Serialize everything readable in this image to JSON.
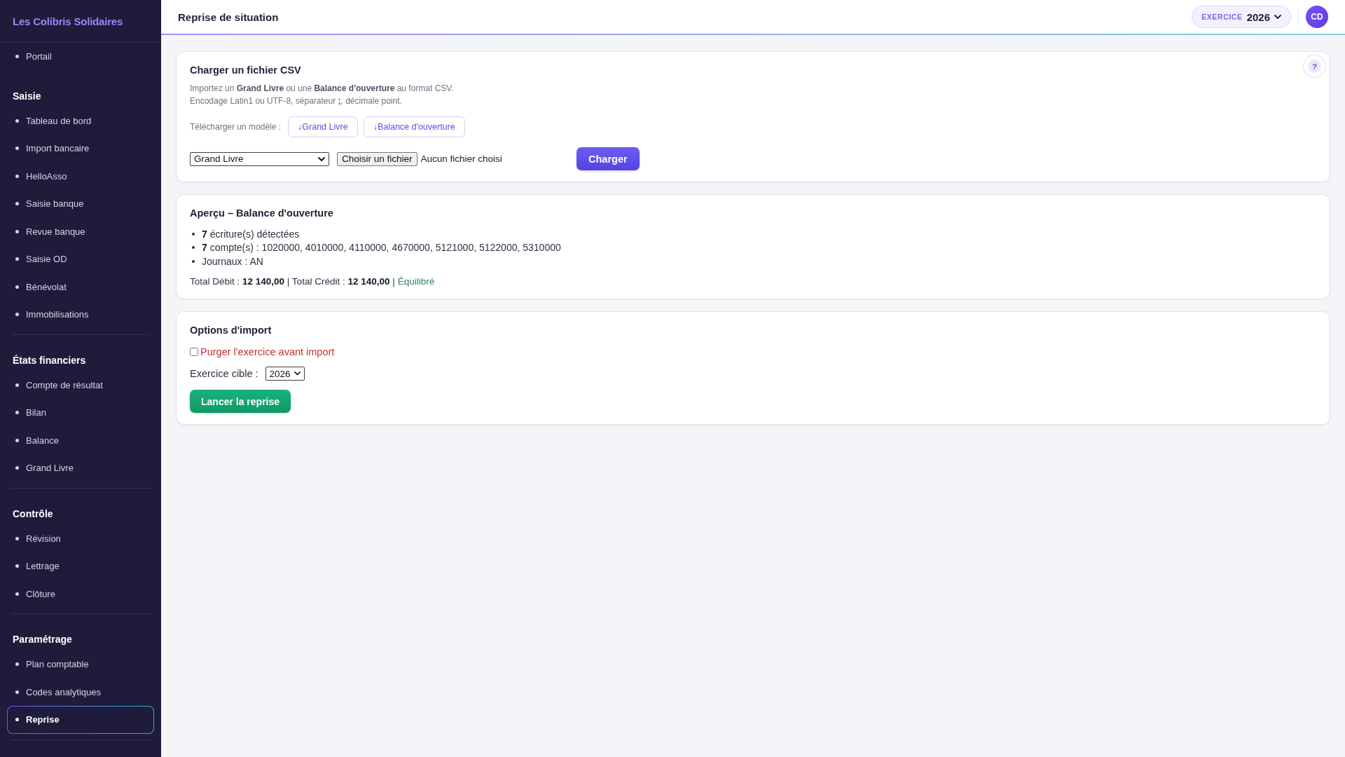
{
  "sidebar": {
    "brand": "Les Colibris Solidaires",
    "links": [
      {
        "label": "Portail",
        "selected": false
      }
    ],
    "sections": [
      {
        "title": "Saisie",
        "items": [
          {
            "label": "Tableau de bord",
            "selected": false
          },
          {
            "label": "Import bancaire",
            "selected": false
          },
          {
            "label": "HelloAsso",
            "selected": false
          },
          {
            "label": "Saisie banque",
            "selected": false
          },
          {
            "label": "Revue banque",
            "selected": false
          },
          {
            "label": "Saisie OD",
            "selected": false
          },
          {
            "label": "Bénévolat",
            "selected": false
          },
          {
            "label": "Immobilisations",
            "selected": false
          }
        ]
      },
      {
        "title": "États financiers",
        "items": [
          {
            "label": "Compte de résultat",
            "selected": false
          },
          {
            "label": "Bilan",
            "selected": false
          },
          {
            "label": "Balance",
            "selected": false
          },
          {
            "label": "Grand Livre",
            "selected": false
          }
        ]
      },
      {
        "title": "Contrôle",
        "items": [
          {
            "label": "Révision",
            "selected": false
          },
          {
            "label": "Lettrage",
            "selected": false
          },
          {
            "label": "Clôture",
            "selected": false
          }
        ]
      },
      {
        "title": "Paramétrage",
        "items": [
          {
            "label": "Plan comptable",
            "selected": false
          },
          {
            "label": "Codes analytiques",
            "selected": false
          },
          {
            "label": "Reprise",
            "selected": true
          }
        ]
      }
    ]
  },
  "header": {
    "title": "Reprise de situation",
    "fiscal_year": {
      "label": "EXERCICE",
      "value": "2026"
    },
    "avatar": "CD"
  },
  "upload_card": {
    "title": "Charger un fichier CSV",
    "help_button": "?",
    "description": [
      "Importez un **Grand Livre** ou une **Balance d'ouverture** au format CSV.",
      "Encodage Latin1 ou UTF-8, séparateur **;**, décimale point."
    ],
    "template_label": "Télécharger un modèle :",
    "template_buttons": [
      "↓Grand Livre",
      "↓Balance d'ouverture"
    ],
    "file_type": "Grand Livre",
    "choose_file": "Choisir un fichier",
    "file_status": "Aucun fichier choisi",
    "submit": "Charger"
  },
  "preview_card": {
    "title": "Aperçu – Balance d'ouverture",
    "items": [
      "**7** écriture(s) détectées",
      "**7** compte(s) : 1020000, 4010000, 4110000, 4670000, 5121000, 5122000, 5310000",
      "Journaux : AN"
    ],
    "totals": "Total Débit : **12 140,00** | Total Crédit : **12 140,00** |",
    "status": "Équilibré",
    "balanced": true
  },
  "options_card": {
    "title": "Options d'import",
    "purge": {
      "label": "Purger l'exercice avant import",
      "checked": false
    },
    "target_label": "Exercice cible :",
    "target_value": "2026",
    "submit": "Lancer la reprise"
  }
}
